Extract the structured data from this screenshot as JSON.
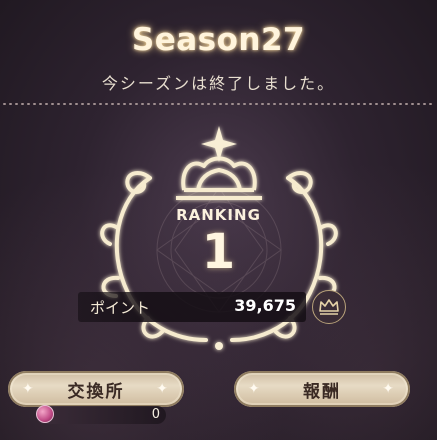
{
  "header": {
    "title": "Season27",
    "subtitle": "今シーズンは終了しました。"
  },
  "ranking": {
    "label": "RANKING",
    "value": "1"
  },
  "points": {
    "label": "ポイント",
    "value": "39,675"
  },
  "buttons": {
    "exchange_label": "交換所",
    "reward_label": "報酬"
  },
  "currency": {
    "value": "0",
    "icon": "pink-gem-icon"
  },
  "colors": {
    "background": "#2e2330",
    "gold": "#f3e6c4",
    "button": "#e7dbc5",
    "button_text": "#3a2a24"
  }
}
